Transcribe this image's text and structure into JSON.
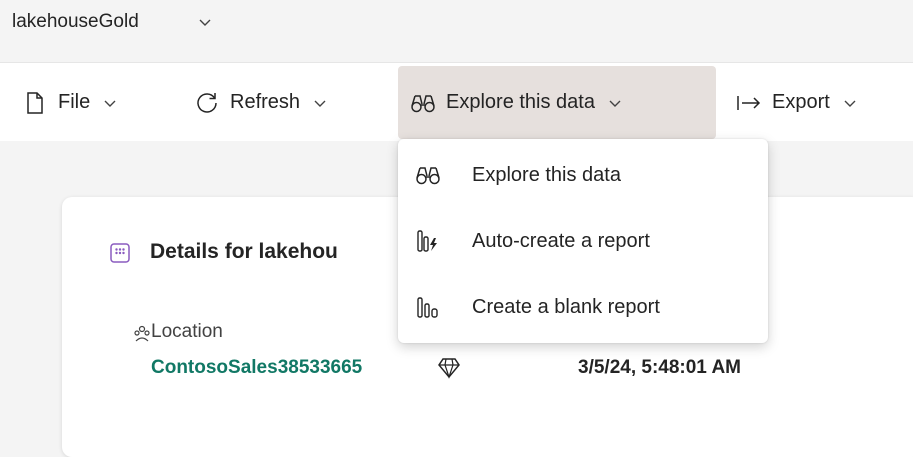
{
  "header": {
    "title": "lakehouseGold"
  },
  "toolbar": {
    "items": [
      {
        "label": "File",
        "icon": "document-icon"
      },
      {
        "label": "Refresh",
        "icon": "refresh-icon"
      },
      {
        "label": "Explore this data",
        "icon": "binoculars-icon",
        "active": true
      },
      {
        "label": "Export",
        "icon": "export-arrow-icon"
      }
    ]
  },
  "dropdown": {
    "items": [
      {
        "label": "Explore this data",
        "icon": "binoculars-icon"
      },
      {
        "label": "Auto-create a report",
        "icon": "auto-report-icon"
      },
      {
        "label": "Create a blank report",
        "icon": "blank-report-icon"
      }
    ]
  },
  "details": {
    "title": "Details for lakehou",
    "location_label": "Location",
    "location_value": "ContosoSales38533665",
    "date_value": "3/5/24, 5:48:01 AM"
  },
  "colors": {
    "active_bg": "#e6e0dd",
    "link_teal": "#117865",
    "page_bg": "#f4f4f4"
  }
}
